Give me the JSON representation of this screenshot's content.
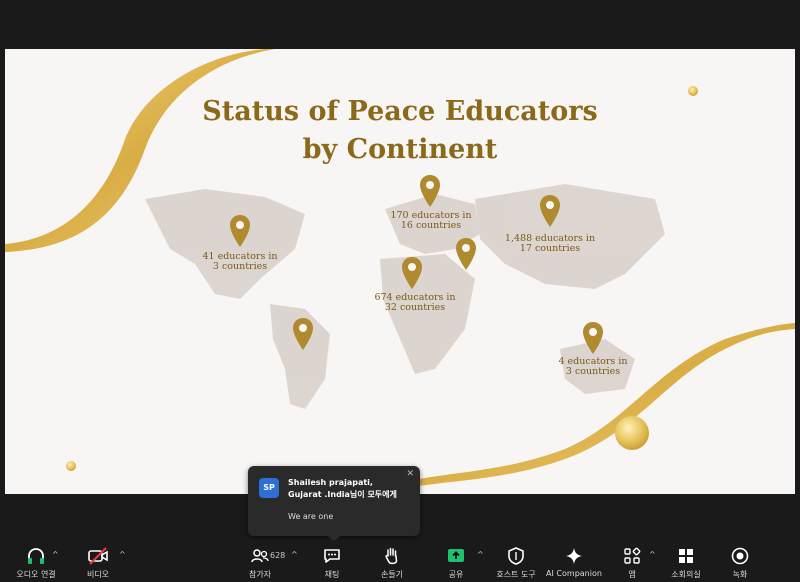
{
  "slide": {
    "title_line1": "Status of Peace Educators",
    "title_line2": "by Continent",
    "continents": [
      {
        "name": "north-america",
        "line1": "41 educators in",
        "line2": "3 countries"
      },
      {
        "name": "europe",
        "line1": "170 educators in",
        "line2": "16 countries"
      },
      {
        "name": "asia",
        "line1": "1,488 educators in",
        "line2": "17 countries"
      },
      {
        "name": "africa",
        "line1": "674 educators in",
        "line2": "32 countries"
      },
      {
        "name": "oceania",
        "line1": "4 educators in",
        "line2": "3 countries"
      }
    ]
  },
  "chat": {
    "avatar_initials": "SP",
    "sender_line1": "Shailesh prajapati,",
    "sender_line2": "Gujarat .India님이 모두에게",
    "message": "We are one",
    "close": "✕"
  },
  "toolbar": {
    "audio_label": "오디오 연결",
    "video_label": "비디오",
    "participants_label": "참가자",
    "participants_count": "628",
    "chat_label": "채팅",
    "raise_hand_label": "손들기",
    "share_label": "공유",
    "host_tools_label": "호스트 도구",
    "ai_companion_label": "AI Companion",
    "apps_label": "앱",
    "breakout_label": "소회의실",
    "record_label": "녹화",
    "caret": "^"
  },
  "colors": {
    "gold": "#b08a2e",
    "title_brown": "#8a6a1a",
    "share_green": "#20c070",
    "avatar_blue": "#2d6fd2"
  }
}
